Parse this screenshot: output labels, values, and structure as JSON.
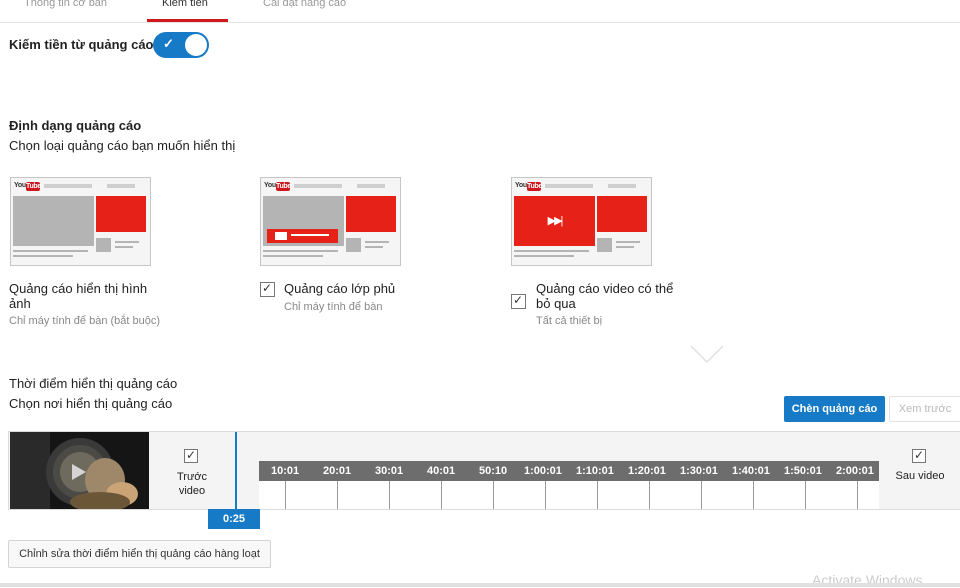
{
  "tabs": [
    {
      "label": "Thông tin cơ bản"
    },
    {
      "label": "Kiếm tiền"
    },
    {
      "label": "Cài đặt nâng cao"
    }
  ],
  "monetization": {
    "label": "Kiếm tiền từ quảng cáo",
    "enabled": true
  },
  "ad_formats": {
    "title": "Định dạng quảng cáo",
    "subtitle": "Chọn loại quảng cáo bạn muốn hiển thị",
    "logo_you": "You",
    "logo_tube": "Tube",
    "items": [
      {
        "label": "Quảng cáo hiển thị hình ảnh",
        "note": "Chỉ máy tính để bàn (bắt buộc)",
        "checkbox": false
      },
      {
        "label": "Quảng cáo lớp phủ",
        "note": "Chỉ máy tính để bàn",
        "checkbox": true,
        "checked": true
      },
      {
        "label": "Quảng cáo video có thể bỏ qua",
        "note": "Tất cả thiết bị",
        "checkbox": true,
        "checked": true,
        "skip_glyph": "▶▶|"
      }
    ]
  },
  "ad_timing": {
    "title": "Thời điểm hiển thị quảng cáo",
    "subtitle": "Chọn nơi hiển thị quảng cáo",
    "insert_button": "Chèn quảng cáo",
    "preview_button": "Xem trước"
  },
  "timeline": {
    "pre_roll": {
      "label_line1": "Trước",
      "label_line2": "video",
      "checked": true
    },
    "post_roll": {
      "label": "Sau video",
      "checked": true
    },
    "current_time": "0:25",
    "ticks": [
      "10:01",
      "20:01",
      "30:01",
      "40:01",
      "50:10",
      "1:00:01",
      "1:10:01",
      "1:20:01",
      "1:30:01",
      "1:40:01",
      "1:50:01",
      "2:00:01"
    ]
  },
  "bulk_edit_button": "Chỉnh sửa thời điểm hiển thị quảng cáo hàng loạt",
  "watermark": "Activate Windows",
  "colors": {
    "accent": "#167ac6",
    "ad_red": "#e62117",
    "youtube_red": "#cc181e"
  }
}
